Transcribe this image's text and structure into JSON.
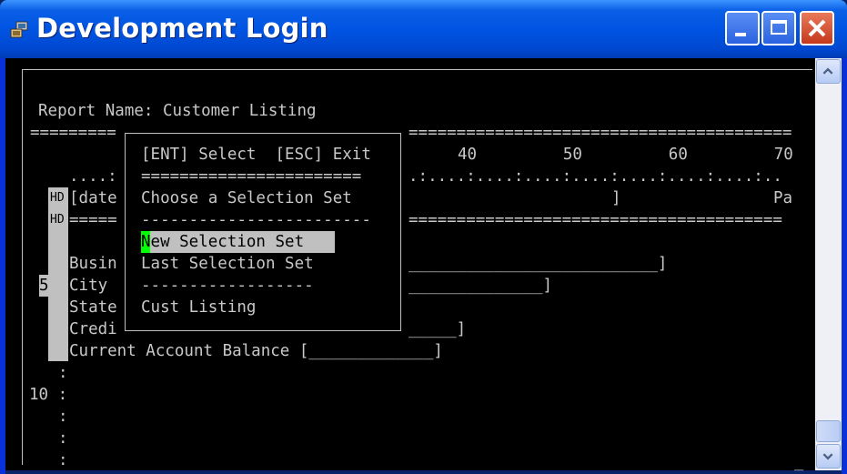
{
  "window": {
    "title": "Development Login",
    "icon": "app-computer-icon",
    "controls": [
      "minimize-icon",
      "maximize-icon",
      "close-icon"
    ]
  },
  "terminal": {
    "report_line": "Report Name: Customer Listing",
    "sep_left": "=========",
    "sep_right": "========================================",
    "ruler_numbers": "40         50         60         70",
    "ruler_left": "....:",
    "ruler_right": ".:....:....:....:....:....:....:....:..",
    "hd_label": "HD",
    "date_frag": "[date",
    "hd_right_bracket": "]",
    "page_frag": "Pa",
    "sep2_left": "=====",
    "sep2_right": "=======================================",
    "fields": [
      {
        "label": "Busin",
        "input": "__________________________]"
      },
      {
        "label": "City",
        "input": "______________]"
      },
      {
        "label": "State",
        "input": ""
      },
      {
        "label": "Credi",
        "input": "_____]"
      }
    ],
    "balance_line": "Current Account Balance [_____________]",
    "line_marker_5": "5",
    "line_marker_10": "10 :",
    "colon": ":"
  },
  "menu": {
    "header": "[ENT] Select  [ESC] Exit",
    "rule": "=======================",
    "title": "Choose a Selection Set",
    "divider": "------------------------",
    "items": [
      "New Selection Set",
      "Last Selection Set"
    ],
    "divider2": "------------------",
    "item3": "Cust Listing",
    "selected_index": 0
  }
}
